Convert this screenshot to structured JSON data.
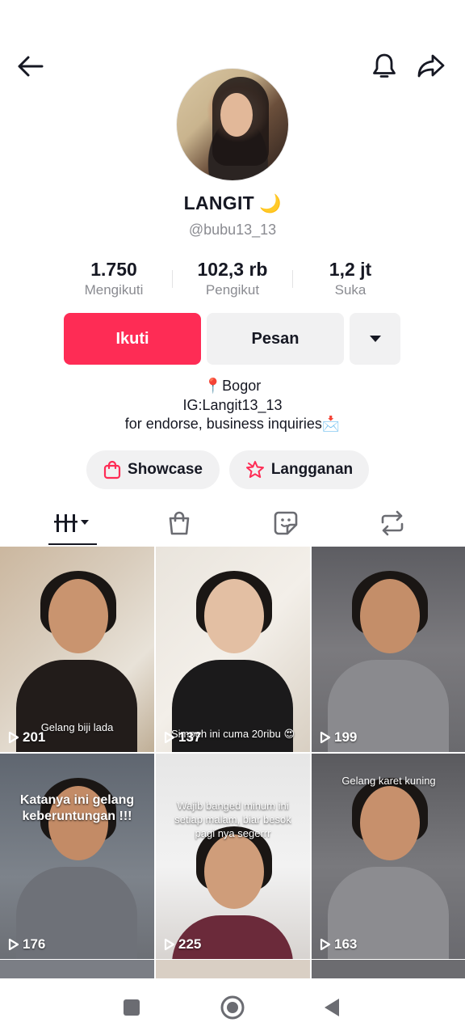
{
  "profile": {
    "name": "LANGIT",
    "name_emoji": "🌙",
    "handle": "@bubu13_13"
  },
  "stats": [
    {
      "value": "1.750",
      "label": "Mengikuti"
    },
    {
      "value": "102,3 rb",
      "label": "Pengikut"
    },
    {
      "value": "1,2 jt",
      "label": "Suka"
    }
  ],
  "actions": {
    "follow": "Ikuti",
    "message": "Pesan"
  },
  "bio": {
    "line1": "📍Bogor",
    "line2": "IG:Langit13_13",
    "line3": "for endorse, business inquiries📩"
  },
  "pills": {
    "showcase": "Showcase",
    "subscription": "Langganan"
  },
  "icons": {
    "back": "arrow-left-icon",
    "bell": "bell-icon",
    "share": "share-icon",
    "tab_videos": "grid-bars-icon",
    "tab_shop": "shopping-bag-icon",
    "tab_liked": "sticker-icon",
    "tab_repost": "repost-icon"
  },
  "videos": [
    {
      "caption": "Gelang biji lada",
      "views": "201"
    },
    {
      "caption": "Simpeh ini cuma 20ribu 😍",
      "views": "137"
    },
    {
      "caption": "",
      "views": "199"
    },
    {
      "caption": "Katanya ini gelang keberuntungan !!!",
      "views": "176"
    },
    {
      "caption": "Wajib banged minum ini setiap malam, biar besok pagi nya segerrr",
      "views": "225"
    },
    {
      "caption": "Gelang karet kuning",
      "views": "163"
    }
  ],
  "colors": {
    "accent": "#fe2c55",
    "text": "#161823",
    "muted": "#8a8b91",
    "secondary_bg": "#f1f1f2"
  }
}
